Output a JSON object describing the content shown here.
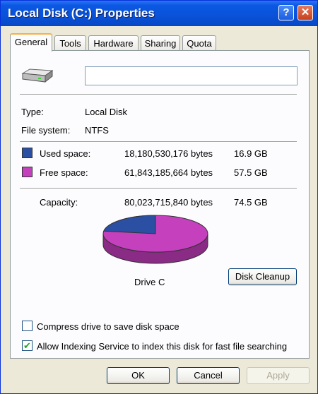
{
  "window": {
    "title": "Local Disk (C:) Properties"
  },
  "titlebar": {
    "help_label": "?",
    "close_label": "✕"
  },
  "tabs": [
    "General",
    "Tools",
    "Hardware",
    "Sharing",
    "Quota"
  ],
  "general": {
    "name_value": "",
    "type_label": "Type:",
    "type_value": "Local Disk",
    "fs_label": "File system:",
    "fs_value": "NTFS",
    "used": {
      "label": "Used space:",
      "bytes": "18,180,530,176 bytes",
      "size": "16.9 GB",
      "color": "#2b4fa3"
    },
    "free": {
      "label": "Free space:",
      "bytes": "61,843,185,664 bytes",
      "size": "57.5 GB",
      "color": "#c540bd"
    },
    "capacity": {
      "label": "Capacity:",
      "bytes": "80,023,715,840 bytes",
      "size": "74.5 GB"
    },
    "used_fraction": 0.227,
    "drive_label": "Drive C",
    "cleanup_label": "Disk Cleanup",
    "compress": {
      "label": "Compress drive to save disk space",
      "checked": false
    },
    "indexing": {
      "label": "Allow Indexing Service to index this disk for fast file searching",
      "checked": true,
      "check_glyph": "✔"
    }
  },
  "buttons": {
    "ok": "OK",
    "cancel": "Cancel",
    "apply": "Apply"
  }
}
